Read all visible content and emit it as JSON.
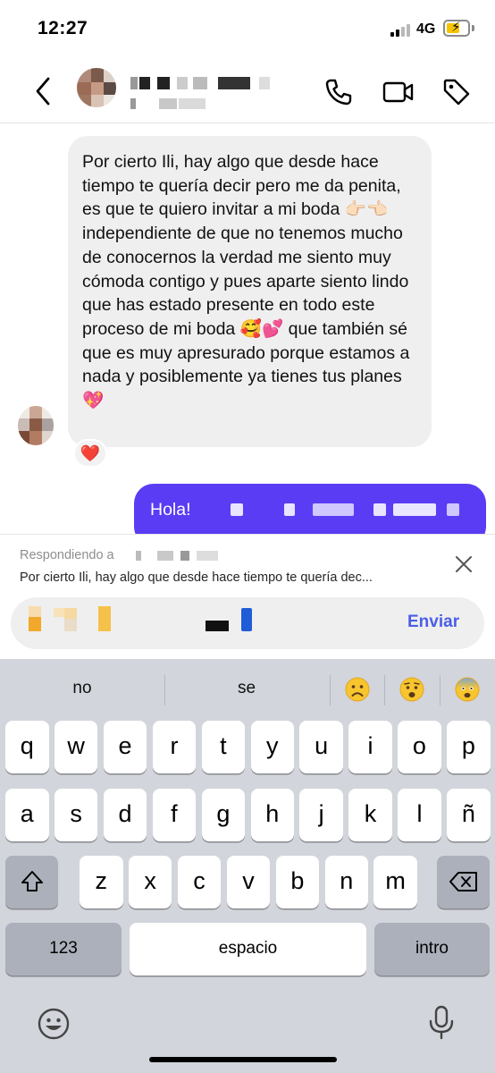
{
  "status": {
    "time": "12:27",
    "network": "4G"
  },
  "colors": {
    "accent": "#4a5ee8",
    "outgoing_bubble": "#5a3cf5",
    "incoming_bubble": "#efefef",
    "keyboard_bg": "#d2d5db"
  },
  "header": {
    "icons": [
      "chevron-left-icon",
      "phone-icon",
      "video-icon",
      "tag-icon"
    ]
  },
  "messages": {
    "incoming": {
      "text": "Por cierto Ili, hay algo que desde hace tiempo te quería decir pero me da penita, es que te quiero invitar a mi boda 👉🏻👈🏻 independiente de que no tenemos mucho de conocernos la verdad me siento muy cómoda contigo y pues aparte siento lindo que has estado presente en todo este proceso de mi boda 🥰💕 que también sé que es muy  apresurado porque estamos a nada y posiblemente ya tienes tus planes 💖",
      "reaction": "❤️"
    },
    "outgoing": {
      "text": "Hola!"
    }
  },
  "reply": {
    "label": "Respondiendo a",
    "snippet": "Por cierto Ili, hay algo que desde hace tiempo te quería dec..."
  },
  "composer": {
    "send_label": "Enviar"
  },
  "keyboard": {
    "suggestions": [
      "no",
      "se"
    ],
    "suggestion_emojis": [
      "😦",
      "😧",
      "😨"
    ],
    "rows": [
      [
        "q",
        "w",
        "e",
        "r",
        "t",
        "y",
        "u",
        "i",
        "o",
        "p"
      ],
      [
        "a",
        "s",
        "d",
        "f",
        "g",
        "h",
        "j",
        "k",
        "l",
        "ñ"
      ],
      [
        "z",
        "x",
        "c",
        "v",
        "b",
        "n",
        "m"
      ]
    ],
    "numbers_label": "123",
    "space_label": "espacio",
    "return_label": "intro"
  }
}
